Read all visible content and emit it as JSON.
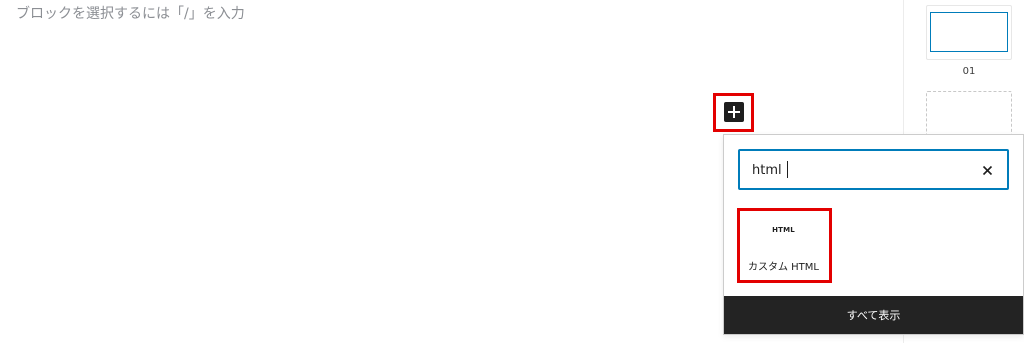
{
  "editor": {
    "placeholder": "ブロックを選択するには「/」を入力"
  },
  "sidebar": {
    "thumbnail_label": "01"
  },
  "inserter": {
    "add_button_icon": "plus-icon",
    "search": {
      "value": "html",
      "clear_icon": "close-icon"
    },
    "results": [
      {
        "icon_text": "HTML",
        "label": "カスタム HTML"
      }
    ],
    "show_all_label": "すべて表示"
  },
  "colors": {
    "accent": "#007cba",
    "highlight": "#e30000",
    "dark": "#1e1e1e"
  }
}
